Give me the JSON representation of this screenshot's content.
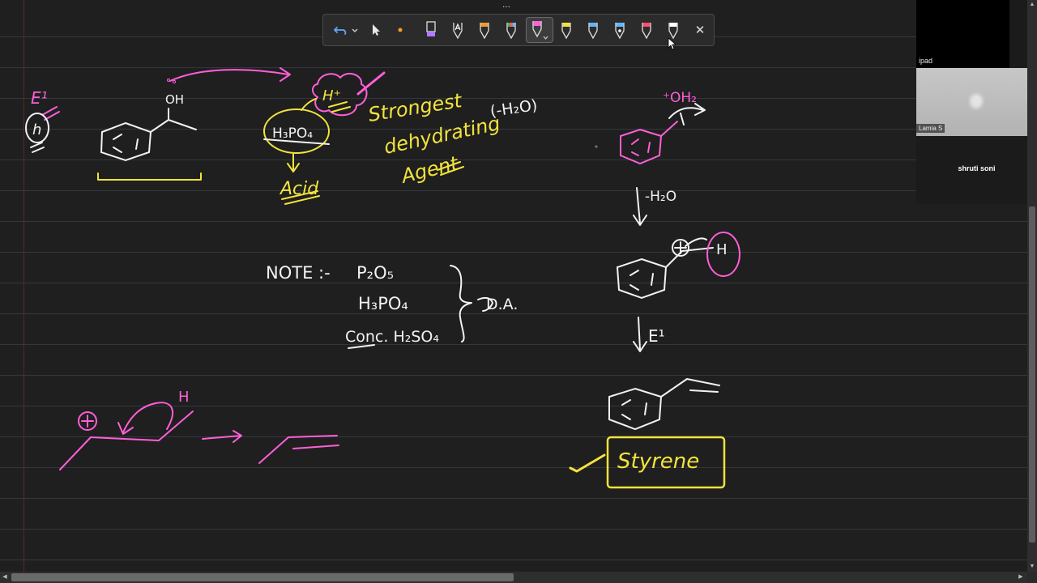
{
  "toolbar": {
    "handle": "...",
    "close_symbol": "✕",
    "tools": [
      {
        "name": "undo",
        "icon": "undo-icon"
      },
      {
        "name": "undo-menu",
        "icon": "chevron-down-icon"
      },
      {
        "name": "select",
        "icon": "cursor-icon"
      },
      {
        "name": "lasso",
        "icon": "dot-icon"
      },
      {
        "name": "highlighter-purple",
        "color": "#b07cff"
      },
      {
        "name": "pen-text",
        "color": "#ffffff"
      },
      {
        "name": "pen-orange",
        "color": "#f29a2e"
      },
      {
        "name": "pen-multicolor",
        "color": "#4caf50"
      },
      {
        "name": "pen-pink",
        "color": "#ff5fd7",
        "selected": true
      },
      {
        "name": "pen-yellow",
        "color": "#f5e23a"
      },
      {
        "name": "pen-blue",
        "color": "#5fb6ff"
      },
      {
        "name": "pen-blue-dot",
        "color": "#5fb6ff"
      },
      {
        "name": "pen-red",
        "color": "#ff4d6d"
      },
      {
        "name": "pen-white",
        "color": "#ffffff"
      }
    ]
  },
  "board": {
    "colors": {
      "white": "#f2f2f2",
      "pink": "#ff5fd7",
      "yellow": "#f3e33c",
      "background": "#1f1f1f"
    },
    "notes": {
      "e1_top": "E¹",
      "h_circle": "h",
      "oh": "OH",
      "h_plus": "H⁺",
      "h3po4": "H₃PO₄",
      "acid": "Acid",
      "strongest": "Strongest",
      "dehydrating": "dehydrating",
      "minus_h2o_paren": "(-H₂O)",
      "agent": "Agent",
      "note_label": "NOTE :-",
      "p2o5": "P₂O₅",
      "h3po4_2": "H₃PO₄",
      "conc_h2so4": "Conc. H₂SO₄",
      "da": "D.A.",
      "oh2_plus": "⁺OH₂",
      "minus_h2o": "-H₂O",
      "h_on_carbocation": "H",
      "e1_arrow": "E¹",
      "h_small": "H",
      "styrene": "Styrene"
    }
  },
  "participants": [
    {
      "name": "ipad"
    },
    {
      "name": "Lamia S"
    },
    {
      "name": "shruti soni"
    }
  ],
  "scrollbars": {
    "up": "▲",
    "down": "▼",
    "left": "◀",
    "right": "▶"
  }
}
